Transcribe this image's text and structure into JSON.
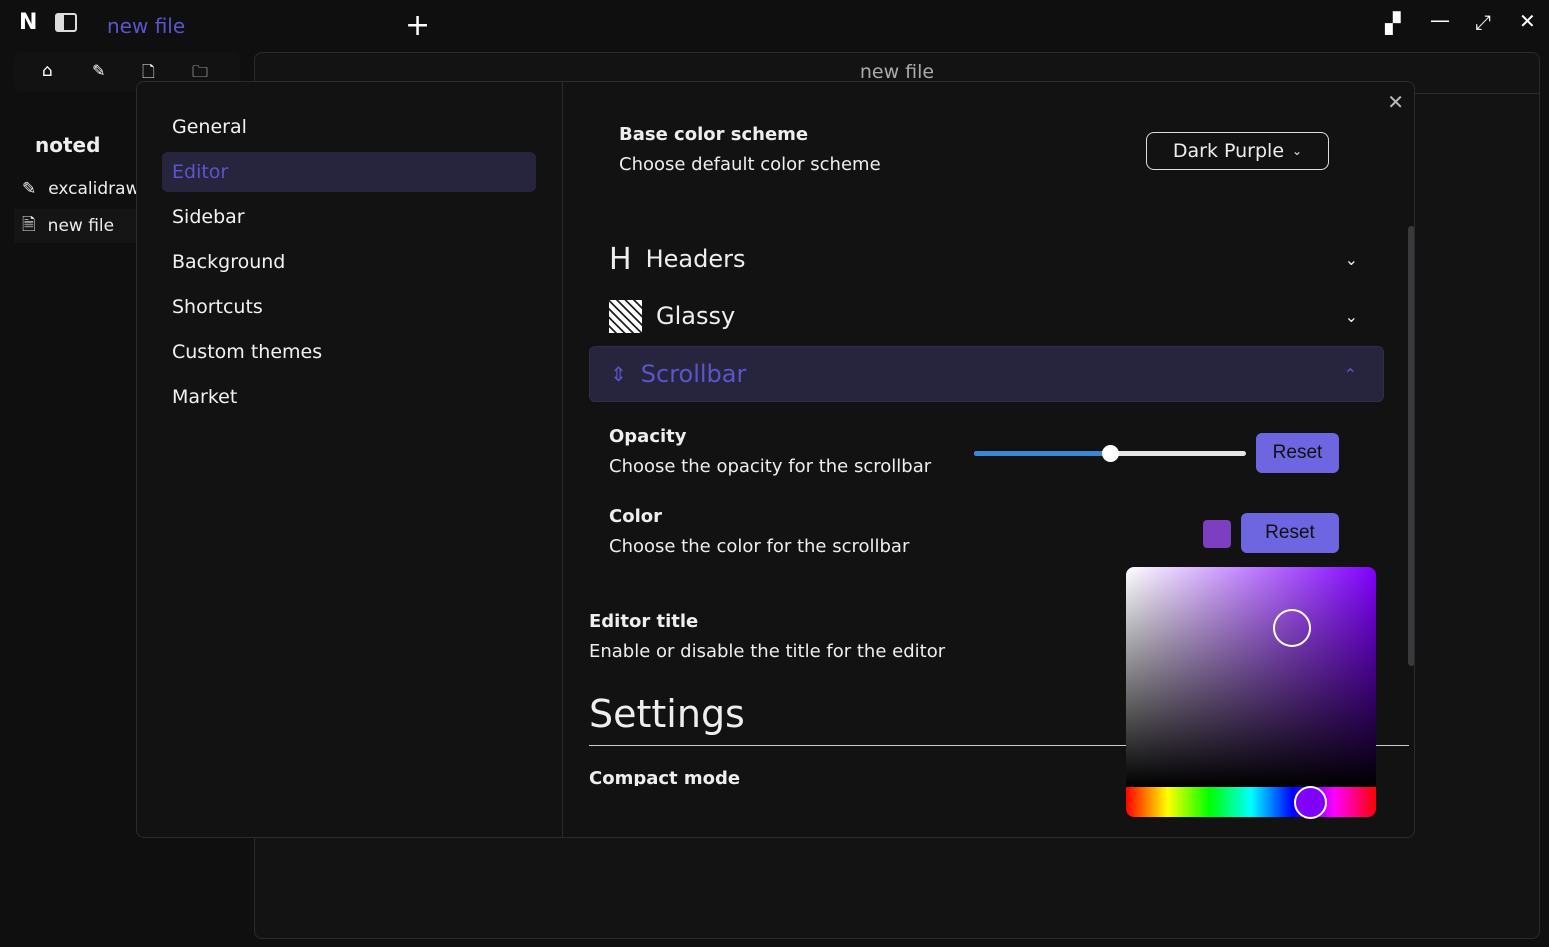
{
  "titlebar": {
    "tab_title": "new file",
    "icons": [
      "noted-logo-icon",
      "sidebar-toggle-icon",
      "plus-icon",
      "layout-icon",
      "minimize-icon",
      "maximize-icon",
      "close-icon"
    ]
  },
  "sidebar": {
    "title": "noted",
    "items": [
      {
        "label": "excalidraw",
        "icon": "excalidraw-icon"
      },
      {
        "label": "new file",
        "icon": "file-icon"
      }
    ]
  },
  "editor": {
    "title": "new file"
  },
  "settings": {
    "nav": [
      "General",
      "Editor",
      "Sidebar",
      "Background",
      "Shortcuts",
      "Custom themes",
      "Market"
    ],
    "active_nav": "Editor",
    "base_scheme": {
      "title": "Base color scheme",
      "desc": "Choose default color scheme",
      "value": "Dark Purple"
    },
    "accordions": [
      {
        "label": "Headers",
        "icon": "heading-icon",
        "open": false
      },
      {
        "label": "Glassy",
        "icon": "glass-icon",
        "open": false
      },
      {
        "label": "Scrollbar",
        "icon": "scroll-icon",
        "open": true
      }
    ],
    "opacity": {
      "title": "Opacity",
      "desc": "Choose the opacity for the scrollbar",
      "value_percent": 50,
      "reset": "Reset"
    },
    "color": {
      "title": "Color",
      "desc": "Choose the color for the scrollbar",
      "value": "#7b3fbf",
      "reset": "Reset"
    },
    "editor_title": {
      "title": "Editor title",
      "desc": "Enable or disable the title for the editor"
    },
    "section": "Settings",
    "compact": {
      "title": "Compact mode"
    }
  },
  "colors": {
    "accent": "#5b55c9",
    "button": "#6d66e0",
    "picker_hue": "#8000ff"
  }
}
